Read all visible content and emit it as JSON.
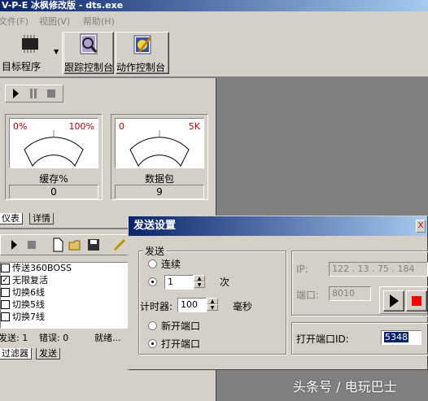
{
  "window": {
    "title": "V-P-E 冰枫修改版 - dts.exe"
  },
  "menu": {
    "file": "文件(F)",
    "view": "视图(V)",
    "help": "帮助(H)"
  },
  "toolbar": {
    "target": "目标程序",
    "trace": "跟踪控制台",
    "action": "动作控制台"
  },
  "gauges": [
    {
      "min": "0%",
      "max": "100%",
      "caption": "缓存%",
      "value": "0"
    },
    {
      "min": "0",
      "max": "5K",
      "caption": "数据包",
      "value": "9"
    }
  ],
  "upper_tabs": {
    "tab1": "仪表",
    "tab2": "详情"
  },
  "list": [
    {
      "label": "传送360BOSS",
      "checked": false
    },
    {
      "label": "无限复活",
      "checked": true
    },
    {
      "label": "切换6线",
      "checked": false
    },
    {
      "label": "切换5线",
      "checked": false
    },
    {
      "label": "切换7线",
      "checked": false
    }
  ],
  "status": {
    "send": "发送: 1",
    "error": "错误: 0",
    "ready": "就绪..."
  },
  "lower_tabs": {
    "tab1": "过滤器",
    "tab2": "发送"
  },
  "dialog": {
    "title": "发送设置",
    "close": "X",
    "send_group": "发送",
    "continuous": "连续",
    "count_value": "1",
    "count_unit": "次",
    "timer_label": "计时器:",
    "timer_value": "100",
    "timer_unit": "毫秒",
    "new_port": "新开端口",
    "open_port": "打开端口",
    "ip_label": "IP:",
    "ip_value": "122 . 13 . 75 . 184",
    "port_label": "端口:",
    "port_value": "8010",
    "open_port_id_label": "打开端口ID:",
    "open_port_id_value": "5348"
  },
  "watermark": "头条号 / 电玩巴士",
  "colors": {
    "titlebar_start": "#0a246a",
    "titlebar_end": "#a6caf0",
    "gauge_red": "#c00000",
    "stop_red": "#ff0000"
  }
}
